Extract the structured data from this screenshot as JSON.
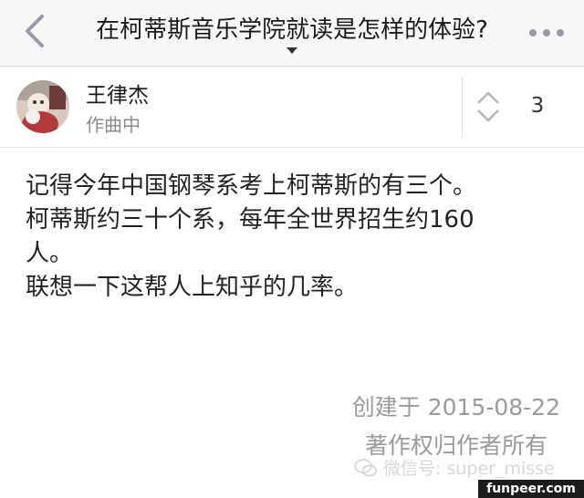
{
  "nav": {
    "title": "在柯蒂斯音乐学院就读是怎样的体验?"
  },
  "author": {
    "name": "王律杰",
    "bio": "作曲中"
  },
  "vote": {
    "count": "3"
  },
  "answer": {
    "lines": [
      "记得今年中国钢琴系考上柯蒂斯的有三个。",
      "柯蒂斯约三十个系，每年全世界招生约160",
      "人。",
      "联想一下这帮人上知乎的几率。"
    ]
  },
  "meta": {
    "created": "创建于 2015-08-22",
    "copyright": "著作权归作者所有"
  },
  "watermark": {
    "text": "微信号: super_misse"
  },
  "site_tag": "funpeer.com",
  "colors": {
    "nav_background": "#f7f7f8",
    "icon_gray": "#9a9aa4",
    "meta_gray": "#9a9a9e"
  },
  "icons": {
    "back": "chevron-left-icon",
    "more": "more-dots-icon",
    "vote": "vote-arrows-icon",
    "wechat": "wechat-icon"
  }
}
